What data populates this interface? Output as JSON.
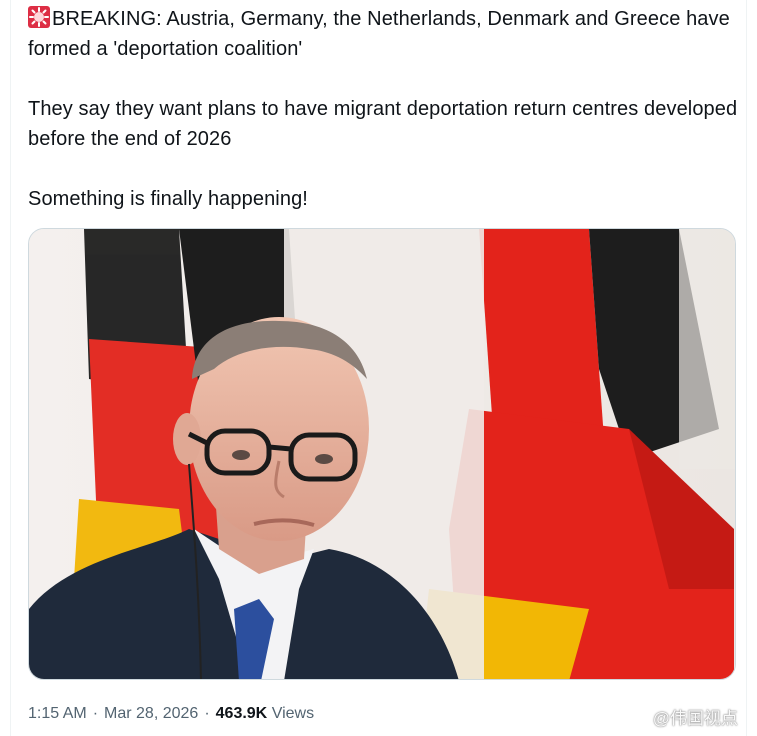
{
  "tweet": {
    "icon": "police-car-light-icon",
    "line1": "BREAKING: Austria, Germany, the Netherlands, Denmark and Greece have formed a 'deportation coalition'",
    "line2": "They say they want plans to have migrant deportation return centres developed before the end of 2026",
    "line3": "Something is finally happening!"
  },
  "media": {
    "image_icon": "photo-man-with-german-flags"
  },
  "meta": {
    "time": "1:15 AM",
    "date": "Mar 28, 2026",
    "views_count": "463.9K",
    "views_label": "Views"
  },
  "watermark": {
    "icon": "weibo-logo-icon",
    "text": "@伟国视点"
  },
  "colors": {
    "text": "#0f1419",
    "muted": "#536471",
    "flag_black": "#1d1d1d",
    "flag_red": "#e3231b",
    "flag_gold": "#f2b705"
  }
}
